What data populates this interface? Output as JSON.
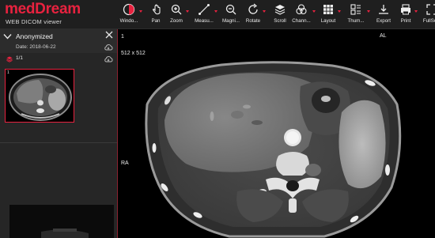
{
  "app": {
    "logo_text": "medDream",
    "logo_subtitle": "WEB DICOM viewer"
  },
  "toolbar": [
    {
      "id": "windowing",
      "label": "Windo...",
      "icon": "windowing-icon",
      "dropdown": true
    },
    {
      "id": "pan",
      "label": "Pan",
      "icon": "pan-icon",
      "dropdown": false
    },
    {
      "id": "zoom",
      "label": "Zoom",
      "icon": "zoom-icon",
      "dropdown": true
    },
    {
      "id": "measure",
      "label": "Measu...",
      "icon": "measure-icon",
      "dropdown": true
    },
    {
      "id": "magnify",
      "label": "Magni...",
      "icon": "magnifier-icon",
      "dropdown": false
    },
    {
      "id": "rotate",
      "label": "Rotate",
      "icon": "rotate-icon",
      "dropdown": true
    },
    {
      "id": "scroll",
      "label": "Scroll",
      "icon": "scroll-icon",
      "dropdown": false
    },
    {
      "id": "channels",
      "label": "Chann...",
      "icon": "channels-icon",
      "dropdown": true
    },
    {
      "id": "layout",
      "label": "Layout",
      "icon": "layout-grid-icon",
      "dropdown": true
    },
    {
      "id": "thumbnails",
      "label": "Thum...",
      "icon": "thumbnails-icon",
      "dropdown": true
    },
    {
      "id": "export",
      "label": "Export",
      "icon": "export-icon",
      "dropdown": false
    },
    {
      "id": "print",
      "label": "Print",
      "icon": "print-icon",
      "dropdown": true
    },
    {
      "id": "fullscreen",
      "label": "FullSc...",
      "icon": "fullscreen-icon",
      "dropdown": false
    }
  ],
  "sidebar": {
    "patient_name": "Anonymized",
    "study_date": "Date:  2018-06-22",
    "series_count": "1/1",
    "thumbnail_number": "1"
  },
  "viewport": {
    "image_number": "1",
    "matrix_size": "512 x 512",
    "orientation_top": "AL",
    "orientation_left": "RA"
  },
  "colors": {
    "accent": "#e8223f",
    "toolbar_bg": "#1f1f1f",
    "sidebar_bg": "#262626"
  }
}
